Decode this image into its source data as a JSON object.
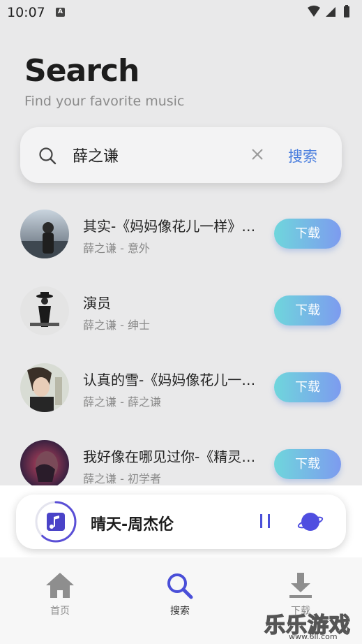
{
  "status_bar": {
    "time": "10:07",
    "indicator": "A",
    "icons": [
      "wifi-icon",
      "signal-icon",
      "battery-icon"
    ]
  },
  "header": {
    "title": "Search",
    "subtitle": "Find your favorite music"
  },
  "search": {
    "query": "薛之谦",
    "button_label": "搜索"
  },
  "songs": [
    {
      "title": "其实-《妈妈像花儿一样》电视剧插曲",
      "artist_album": "薛之谦 - 意外",
      "download_label": "下载"
    },
    {
      "title": "演员",
      "artist_album": "薛之谦 - 绅士",
      "download_label": "下载"
    },
    {
      "title": "认真的雪-《妈妈像花儿一样》电视剧插曲",
      "artist_album": "薛之谦 - 薛之谦",
      "download_label": "下载"
    },
    {
      "title": "我好像在哪见过你-《精灵王座》主题曲",
      "artist_album": "薛之谦 - 初学者",
      "download_label": "下载"
    }
  ],
  "player": {
    "now_playing": "晴天-周杰伦",
    "progress": 0.62
  },
  "nav": {
    "items": [
      {
        "label": "首页",
        "icon": "home-icon",
        "active": false
      },
      {
        "label": "搜索",
        "icon": "search-icon",
        "active": true
      },
      {
        "label": "下载",
        "icon": "download-icon",
        "active": false
      }
    ]
  },
  "colors": {
    "accent": "#4a4fd8",
    "search_button": "#4a7ede",
    "download_start": "#6fd6dc",
    "download_end": "#7d9bef",
    "inactive_nav": "#8e8e8e"
  },
  "watermark": {
    "text": "乐乐游戏",
    "url": "www.6ll.com"
  }
}
